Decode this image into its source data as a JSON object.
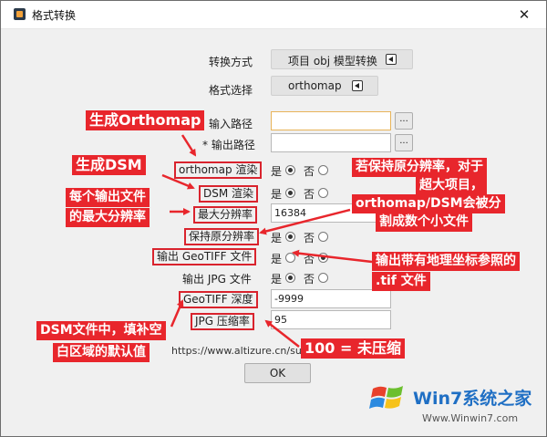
{
  "window": {
    "title": "格式转换",
    "close_label": "✕"
  },
  "form": {
    "convert_method_label": "转换方式",
    "convert_method_value": "项目 obj 模型转换",
    "format_label": "格式选择",
    "format_value": "orthomap",
    "input_path_label": "输入路径",
    "input_path_value": "",
    "output_path_label": "* 输出路径",
    "output_path_value": "",
    "browse_label": "...",
    "orthomap_render_label": "orthomap 渲染",
    "dsm_render_label": "DSM 渲染",
    "max_resolution_label": "最大分辨率",
    "max_resolution_value": "16384",
    "keep_resolution_label": "保持原分辨率",
    "geotiff_label": "输出 GeoTIFF 文件",
    "jpg_label": "输出 JPG 文件",
    "geotiff_depth_label": "GeoTIFF 深度",
    "geotiff_depth_value": "-9999",
    "jpg_compress_label": "JPG 压缩率",
    "jpg_compress_value": "95",
    "yes_label": "是",
    "no_label": "否",
    "url_text": "https://www.altizure.cn/support/article",
    "ok_label": "OK"
  },
  "annotations": {
    "gen_orthomap": "生成Orthomap",
    "gen_dsm": "生成DSM",
    "max_res_line1": "每个输出文件",
    "max_res_line2": "的最大分辨率",
    "keep_res_line1": "若保持原分辨率，对于",
    "keep_res_line2": "超大项目，",
    "keep_res_line3": "orthomap/DSM会被分",
    "keep_res_line4": "割成数个小文件",
    "geotiff_line1": "输出带有地理坐标参照的",
    "geotiff_line2": ".tif 文件",
    "dsm_fill_line1": "DSM文件中，填补空",
    "dsm_fill_line2": "白区域的默认值",
    "jpg_note": "100 = 未压缩"
  },
  "watermark": {
    "main": "Win7系统之家",
    "url": "Www.Winwin7.com"
  },
  "colors": {
    "annotation_red": "#e8262c",
    "window_bg": "#f0f0f0",
    "watermark_blue": "#1f6fc4"
  }
}
